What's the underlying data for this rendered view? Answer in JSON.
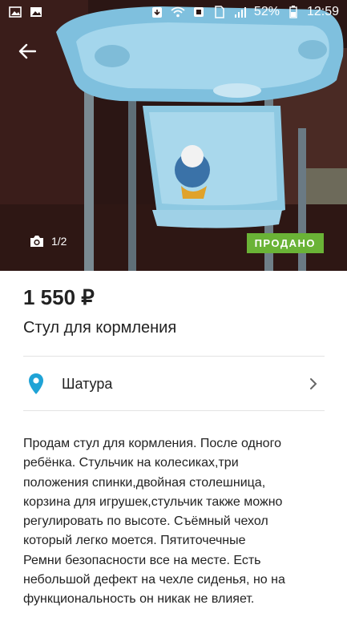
{
  "status_bar": {
    "battery_percent": "52%",
    "time": "12:59",
    "icons": [
      "image-icon",
      "gallery-icon",
      "download-icon",
      "wifi-icon",
      "nfc-icon",
      "sim-icon",
      "signal-icon",
      "battery-icon"
    ]
  },
  "gallery": {
    "counter": "1/2",
    "badge": "ПРОДАНО",
    "badge_color": "#6ab336"
  },
  "listing": {
    "price": "1 550 ₽",
    "title": "Стул для кормления",
    "location": "Шатура",
    "description": "Продам стул для кормления. После одного\nребёнка. Стульчик на колесиках,три\nположения спинки,двойная столешница,\nкорзина для игрушек,стульчик также можно\nрегулировать по высоте. Съёмный чехол\nкоторый легко моется. Пятиточечные\nРемни безопасности все на месте. Есть\nнебольшой дефект на чехле сиденья, но на\nфункциональность он никак не влияет."
  },
  "colors": {
    "pin": "#1fa3d6",
    "text": "#222222",
    "divider": "#e3e3e3"
  }
}
